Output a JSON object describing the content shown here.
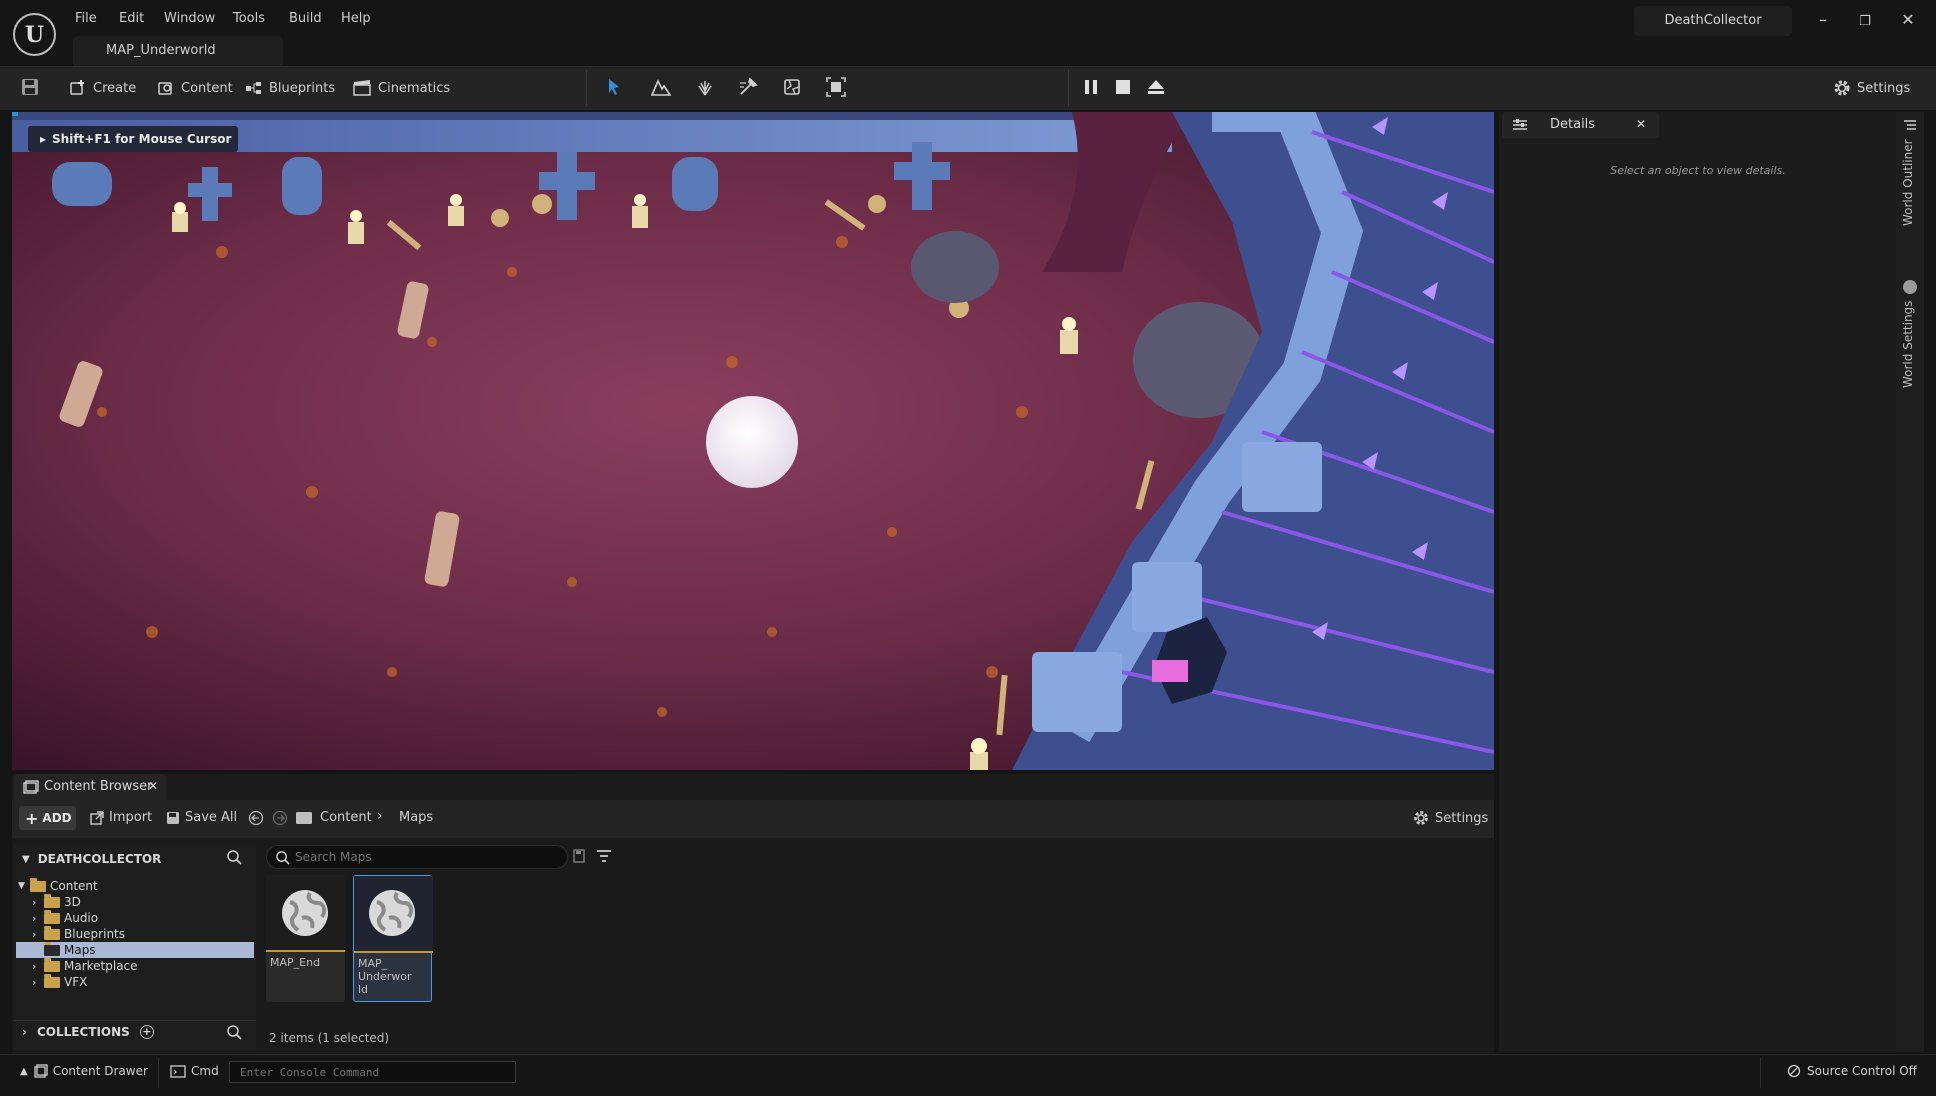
{
  "app": {
    "logo_text": "U",
    "menu": [
      "File",
      "Edit",
      "Window",
      "Tools",
      "Build",
      "Help"
    ],
    "map_tab": "MAP_Underworld",
    "project_name": "DeathCollector",
    "window_buttons": {
      "minimize": "–",
      "restore": "❐",
      "close": "✕"
    }
  },
  "toolbar": {
    "create_label": "Create",
    "content_label": "Content",
    "blueprints_label": "Blueprints",
    "cinematics_label": "Cinematics",
    "settings_label": "Settings",
    "modes": [
      "select-mode-icon",
      "landscape-mode-icon",
      "foliage-mode-icon",
      "mesh-paint-mode-icon",
      "fracture-mode-icon",
      "modeling-mode-icon"
    ],
    "play_controls": [
      "pause-icon",
      "stop-icon",
      "eject-icon"
    ],
    "accent": "#2f8fd8"
  },
  "viewport": {
    "hint": "Shift+F1 for Mouse Cursor"
  },
  "details": {
    "tab_label": "Details",
    "empty_text": "Select an object to view details.",
    "side_tabs": [
      "World Outliner",
      "World Settings"
    ]
  },
  "content_browser": {
    "tab_label": "Content Browser",
    "add_label": "ADD",
    "import_label": "Import",
    "save_all_label": "Save All",
    "breadcrumb": [
      "Content",
      "Maps"
    ],
    "settings_label": "Settings",
    "tree_header": "DEATHCOLLECTOR",
    "search_placeholder": "Search Maps",
    "tree": [
      {
        "label": "Content",
        "expanded": true
      },
      {
        "label": "3D"
      },
      {
        "label": "Audio"
      },
      {
        "label": "Blueprints"
      },
      {
        "label": "Maps",
        "selected": true
      },
      {
        "label": "Marketplace"
      },
      {
        "label": "VFX"
      }
    ],
    "assets": [
      {
        "label": "MAP_End",
        "selected": false
      },
      {
        "label": "MAP_ Underworld",
        "selected": true
      }
    ],
    "collections_label": "COLLECTIONS",
    "status": "2 items (1 selected)"
  },
  "statusbar": {
    "content_drawer_label": "Content Drawer",
    "cmd_label": "Cmd",
    "console_placeholder": "Enter Console Command",
    "source_control_label": "Source Control Off"
  }
}
